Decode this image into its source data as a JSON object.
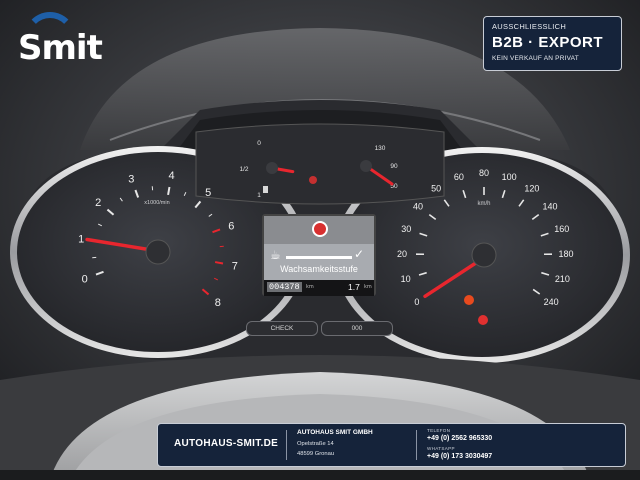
{
  "logo": {
    "text": "Smit"
  },
  "badge": {
    "top": "AUSSCHLIESSLICH",
    "main": "B2B  ·  EXPORT",
    "sub": "KEIN VERKAUF AN PRIVAT"
  },
  "tachometer": {
    "unit": "x1000/min",
    "ticks": [
      "0",
      "1",
      "2",
      "3",
      "4",
      "5",
      "6",
      "7",
      "8"
    ],
    "needle_rpm_x1000": 1.0
  },
  "fuel": {
    "ticks": [
      "0",
      "1/2",
      "1"
    ],
    "level_fraction": 0.5
  },
  "temperature": {
    "ticks": [
      "50",
      "90",
      "130"
    ],
    "needle_celsius": 50
  },
  "speedometer": {
    "unit": "km/h",
    "ticks": [
      "0",
      "10",
      "20",
      "30",
      "40",
      "50",
      "60",
      "80",
      "100",
      "120",
      "140",
      "160",
      "180",
      "210",
      "240"
    ],
    "needle_kmh": 0
  },
  "display": {
    "message": "Wachsamkeitsstufe",
    "odometer": "004378",
    "odometer_unit": "km",
    "trip": "1.7",
    "trip_unit": "km"
  },
  "buttons": {
    "check": "CHECK",
    "odo": "000"
  },
  "footer": {
    "website": "AUTOHAUS-SMIT.DE",
    "company": "AUTOHAUS SMIT GMBH",
    "street": "Opelstraße 14",
    "city": "48599 Gronau",
    "phone_label": "TELEFON",
    "phone": "+49 (0) 2562 965330",
    "whatsapp_label": "WHATSAPP",
    "whatsapp": "+49 (0) 173 3030497"
  },
  "colors": {
    "needle": "#e8262e",
    "brand_blue": "#1e5fa8",
    "banner_bg": "#15233a"
  }
}
